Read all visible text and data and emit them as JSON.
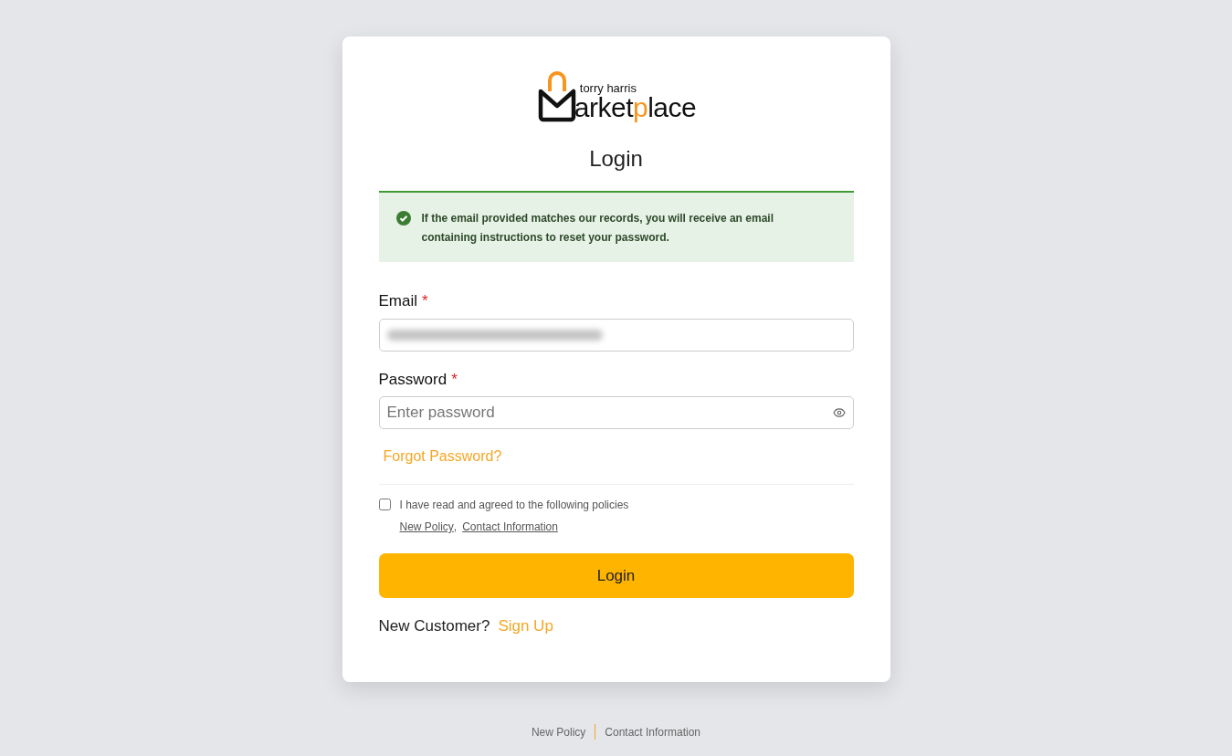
{
  "logo": {
    "tagline": "torry harris",
    "word_parts": [
      {
        "text": "arket",
        "accent": false
      },
      {
        "text": "p",
        "accent": true
      },
      {
        "text": "lace",
        "accent": false
      }
    ]
  },
  "title": "Login",
  "alert": {
    "kind": "success",
    "message": "If the email provided matches our records, you will receive an email containing instructions to reset your password."
  },
  "fields": [
    {
      "kind": "text",
      "label": "Email",
      "required_mark": "*",
      "blurred": true
    },
    {
      "kind": "password",
      "label": "Password",
      "required_mark": "*",
      "placeholder": "Enter password"
    }
  ],
  "forgot_link": "Forgot Password?",
  "consent": {
    "checked": false,
    "text": "I have read and agreed to the following policies",
    "links": [
      "New Policy",
      "Contact Information"
    ],
    "separator": ","
  },
  "login_button": "Login",
  "signup": {
    "prompt": "New Customer?",
    "link": "Sign Up"
  },
  "footer_links": [
    "New Policy",
    "Contact Information"
  ]
}
